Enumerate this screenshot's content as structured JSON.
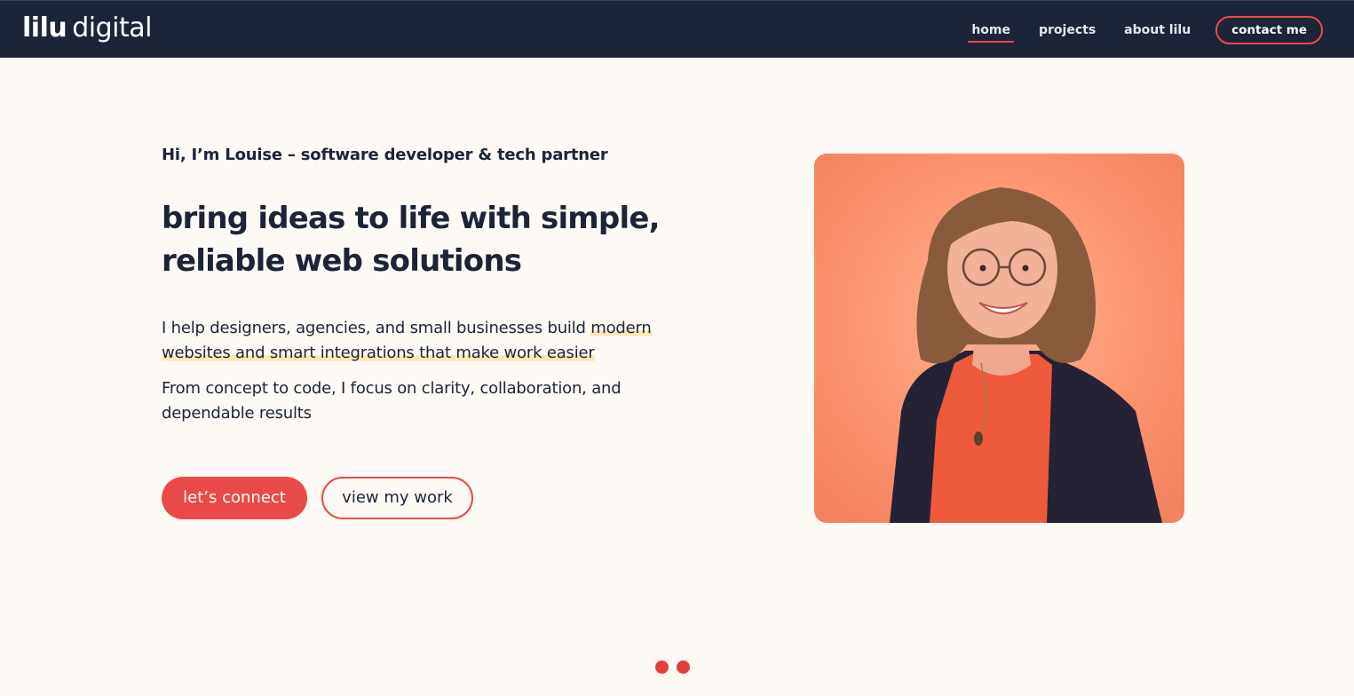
{
  "brand": {
    "name_bold": "lilu",
    "name_light": "digital"
  },
  "nav": {
    "items": [
      {
        "label": "home",
        "active": true
      },
      {
        "label": "projects",
        "active": false
      },
      {
        "label": "about lilu",
        "active": false
      }
    ],
    "contact_label": "contact me"
  },
  "hero": {
    "intro": "Hi, I’m Louise – software developer & tech partner",
    "headline_line1": "bring ideas to life with simple,",
    "headline_line2": "reliable web solutions",
    "paragraph1_plain": "I help designers, agencies, and small businesses build ",
    "paragraph1_highlight": "modern websites and smart integrations that make work easier",
    "paragraph2": "From concept to code, I focus on clarity, collaboration, and dependable results",
    "primary_cta": "let’s connect",
    "secondary_cta": "view my work"
  },
  "colors": {
    "navy": "#1c2438",
    "accent": "#e94a47",
    "background": "#fdf9f4",
    "highlight": "#fbe8b7",
    "photo_bg": "#fb946e"
  },
  "icons": {
    "photo": "portrait-photo",
    "pagination": "pagination-dot"
  }
}
